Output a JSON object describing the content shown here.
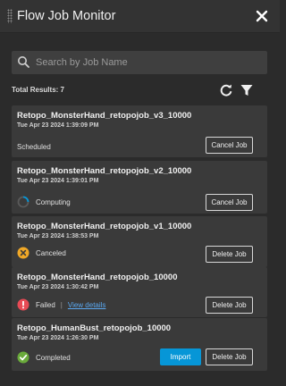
{
  "header": {
    "title": "Flow Job Monitor"
  },
  "search": {
    "placeholder": "Search by Job Name"
  },
  "results": {
    "total_label": "Total Results: 7"
  },
  "colors": {
    "accent": "#0696d7",
    "error": "#e84a55",
    "warning": "#f0a827",
    "success": "#6aaa3b"
  },
  "jobs": [
    {
      "name": "Retopo_MonsterHand_retopojob_v3_10000",
      "date": "Tue Apr 23 2024 1:39:09 PM",
      "status": "Scheduled",
      "status_icon": "none",
      "action": "Cancel Job"
    },
    {
      "name": "Retopo_MonsterHand_retopojob_v2_10000",
      "date": "Tue Apr 23 2024 1:39:01 PM",
      "status": "Computing",
      "status_icon": "spinner-icon",
      "action": "Cancel Job"
    },
    {
      "name": "Retopo_MonsterHand_retopojob_v1_10000",
      "date": "Tue Apr 23 2024 1:38:53 PM",
      "status": "Canceled",
      "status_icon": "cancel-icon",
      "action": "Delete Job"
    },
    {
      "name": "Retopo_MonsterHand_retopojob_10000",
      "date": "Tue Apr 23 2024 1:30:42 PM",
      "status": "Failed",
      "status_icon": "error-icon",
      "link": "View details",
      "action": "Delete Job"
    },
    {
      "name": "Retopo_HumanBust_retopojob_10000",
      "date": "Tue Apr 23 2024 1:26:30 PM",
      "status": "Completed",
      "status_icon": "check-icon",
      "primary_action": "Import",
      "action": "Delete Job"
    }
  ]
}
